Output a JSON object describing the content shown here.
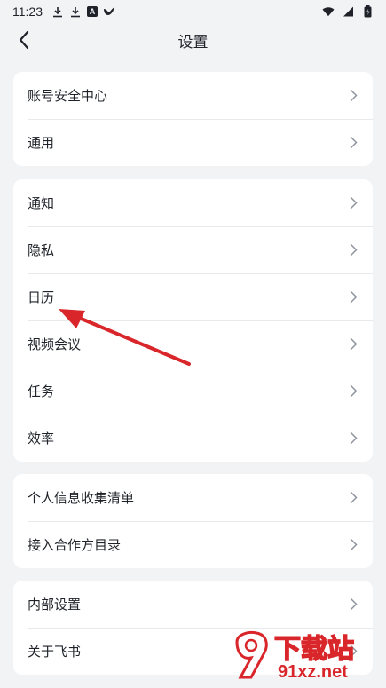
{
  "status_bar": {
    "time": "11:23",
    "left_icons": [
      "download-icon",
      "download-icon",
      "a-box-icon",
      "bird-icon"
    ],
    "right_icons": [
      "wifi-icon",
      "signal-icon",
      "battery-icon"
    ],
    "a_box_text": "A"
  },
  "header": {
    "title": "设置",
    "back_icon": "chevron-left-icon"
  },
  "groups": [
    {
      "items": [
        {
          "label": "账号安全中心"
        },
        {
          "label": "通用"
        }
      ]
    },
    {
      "items": [
        {
          "label": "通知"
        },
        {
          "label": "隐私"
        },
        {
          "label": "日历"
        },
        {
          "label": "视频会议"
        },
        {
          "label": "任务"
        },
        {
          "label": "效率"
        }
      ]
    },
    {
      "items": [
        {
          "label": "个人信息收集清单"
        },
        {
          "label": "接入合作方目录"
        }
      ]
    },
    {
      "items": [
        {
          "label": "内部设置"
        },
        {
          "label": "关于飞书"
        }
      ]
    }
  ],
  "annotation": {
    "arrow_color": "#d9262a",
    "points_to": "日历"
  },
  "watermark": {
    "brand": "下载站",
    "url": "91xz.net",
    "color": "#d9262a"
  },
  "colors": {
    "background": "#f2f3f5",
    "card": "#ffffff",
    "divider": "#e8e9eb",
    "chevron": "#8f959e",
    "text": "#1f2329"
  }
}
